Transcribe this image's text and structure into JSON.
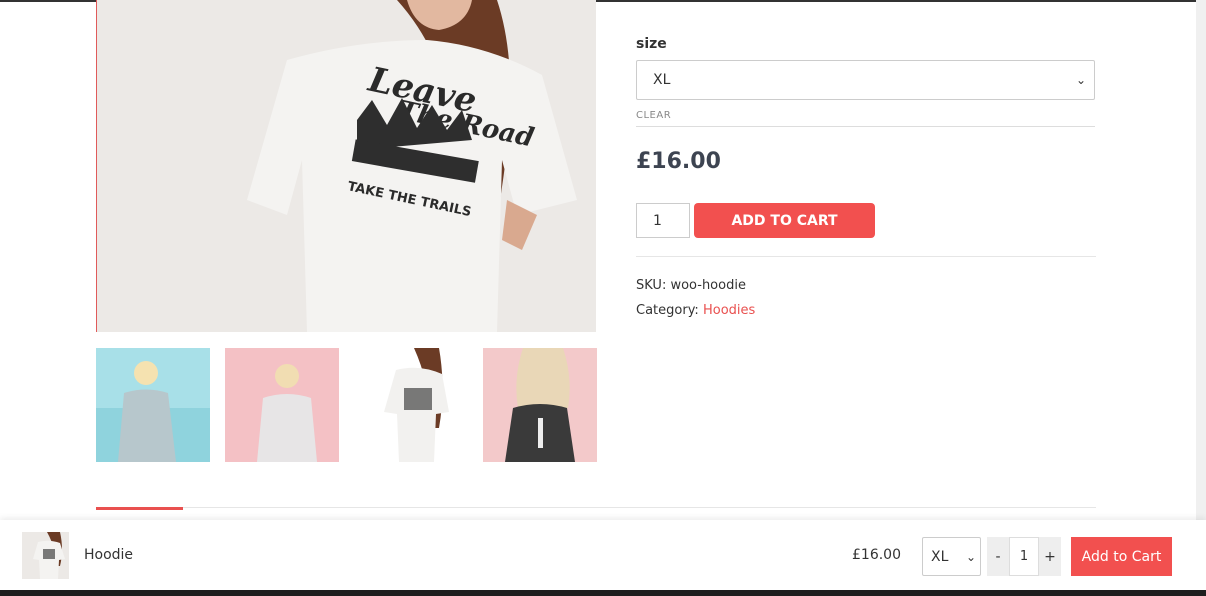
{
  "product": {
    "name": "Hoodie",
    "price": "£16.00",
    "sku_label": "SKU:",
    "sku_value": "woo-hoodie",
    "category_label": "Category:",
    "category_value": "Hoodies"
  },
  "variation": {
    "label": "size",
    "selected": "XL",
    "clear_label": "CLEAR"
  },
  "cart": {
    "quantity": "1",
    "add_label": "ADD TO CART"
  },
  "sticky": {
    "name": "Hoodie",
    "price": "£16.00",
    "size": "XL",
    "minus": "-",
    "plus": "+",
    "quantity": "1",
    "add_label": "Add to Cart"
  },
  "icons": {
    "select_chevron": "chevron-down-icon"
  },
  "colors": {
    "accent": "#f2504f",
    "link": "#e9504f",
    "price": "#3d4451"
  }
}
